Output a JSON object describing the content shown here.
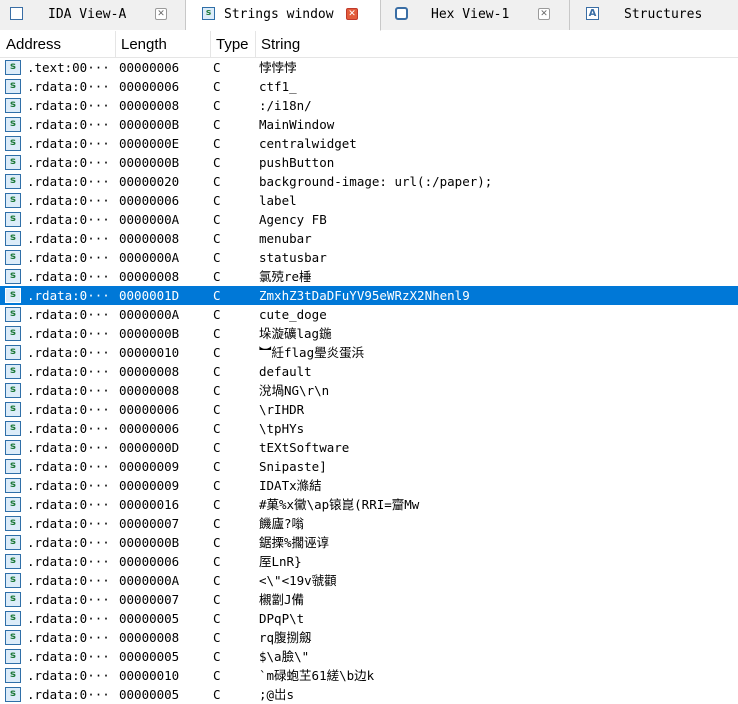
{
  "tabs": [
    {
      "label": "IDA View-A",
      "icon": "ida-view-icon",
      "active": false
    },
    {
      "label": "Strings window",
      "icon": "strings-icon",
      "active": true
    },
    {
      "label": "Hex View-1",
      "icon": "hex-view-icon",
      "active": false
    },
    {
      "label": "Structures",
      "icon": "structures-icon",
      "active": false
    }
  ],
  "columns": {
    "address": "Address",
    "length": "Length",
    "type": "Type",
    "string": "String"
  },
  "row_icon_glyph": "s",
  "colors": {
    "selected_row": "#0078d7",
    "active_close": "#e25c3b"
  },
  "rows": [
    {
      "address": ".text:00···",
      "length": "00000006",
      "type": "C",
      "string": "悖悖悖"
    },
    {
      "address": ".rdata:0···",
      "length": "00000006",
      "type": "C",
      "string": "ctf1_"
    },
    {
      "address": ".rdata:0···",
      "length": "00000008",
      "type": "C",
      "string": ":/i18n/"
    },
    {
      "address": ".rdata:0···",
      "length": "0000000B",
      "type": "C",
      "string": "MainWindow"
    },
    {
      "address": ".rdata:0···",
      "length": "0000000E",
      "type": "C",
      "string": "centralwidget"
    },
    {
      "address": ".rdata:0···",
      "length": "0000000B",
      "type": "C",
      "string": "pushButton"
    },
    {
      "address": ".rdata:0···",
      "length": "00000020",
      "type": "C",
      "string": "background-image: url(:/paper);"
    },
    {
      "address": ".rdata:0···",
      "length": "00000006",
      "type": "C",
      "string": "label"
    },
    {
      "address": ".rdata:0···",
      "length": "0000000A",
      "type": "C",
      "string": "Agency FB"
    },
    {
      "address": ".rdata:0···",
      "length": "00000008",
      "type": "C",
      "string": "menubar"
    },
    {
      "address": ".rdata:0···",
      "length": "0000000A",
      "type": "C",
      "string": "statusbar"
    },
    {
      "address": ".rdata:0···",
      "length": "00000008",
      "type": "C",
      "string": "氯殑re棰"
    },
    {
      "address": ".rdata:0···",
      "length": "0000001D",
      "type": "C",
      "string": "ZmxhZ3tDaDFuYV95eWRzX2Nhenl9",
      "selected": true
    },
    {
      "address": ".rdata:0···",
      "length": "0000000A",
      "type": "C",
      "string": "cute_doge"
    },
    {
      "address": ".rdata:0···",
      "length": "0000000B",
      "type": "C",
      "string": "垛漩礦lag鍦"
    },
    {
      "address": ".rdata:0···",
      "length": "00000010",
      "type": "C",
      "string": "︼紝flag璺炎蛋浜"
    },
    {
      "address": ".rdata:0···",
      "length": "00000008",
      "type": "C",
      "string": "default"
    },
    {
      "address": ".rdata:0···",
      "length": "00000008",
      "type": "C",
      "string": "涗堝NG\\r\\n"
    },
    {
      "address": ".rdata:0···",
      "length": "00000006",
      "type": "C",
      "string": "\\rIHDR"
    },
    {
      "address": ".rdata:0···",
      "length": "00000006",
      "type": "C",
      "string": "\\tpHYs"
    },
    {
      "address": ".rdata:0···",
      "length": "0000000D",
      "type": "C",
      "string": "tEXtSoftware"
    },
    {
      "address": ".rdata:0···",
      "length": "00000009",
      "type": "C",
      "string": "Snipaste]"
    },
    {
      "address": ".rdata:0···",
      "length": "00000009",
      "type": "C",
      "string": "IDATx滌結"
    },
    {
      "address": ".rdata:0···",
      "length": "00000016",
      "type": "C",
      "string": "#菓%x黴\\ap锿崑(RRI=齏Mw"
    },
    {
      "address": ".rdata:0···",
      "length": "00000007",
      "type": "C",
      "string": "饑廬?嗡"
    },
    {
      "address": ".rdata:0···",
      "length": "0000000B",
      "type": "C",
      "string": "鋸搮%擱诬谆"
    },
    {
      "address": ".rdata:0···",
      "length": "00000006",
      "type": "C",
      "string": "厔LnR}"
    },
    {
      "address": ".rdata:0···",
      "length": "0000000A",
      "type": "C",
      "string": "<\\\"<19v虢顴"
    },
    {
      "address": ".rdata:0···",
      "length": "00000007",
      "type": "C",
      "string": "櫬劏J備"
    },
    {
      "address": ".rdata:0···",
      "length": "00000005",
      "type": "C",
      "string": "DPqP\\t"
    },
    {
      "address": ".rdata:0···",
      "length": "00000008",
      "type": "C",
      "string": "rq腹捌劔"
    },
    {
      "address": ".rdata:0···",
      "length": "00000005",
      "type": "C",
      "string": "$\\a臉\\\""
    },
    {
      "address": ".rdata:0···",
      "length": "00000010",
      "type": "C",
      "string": "`m碌蚫芏61縒\\b边k"
    },
    {
      "address": ".rdata:0···",
      "length": "00000005",
      "type": "C",
      "string": ";@岀s"
    }
  ]
}
